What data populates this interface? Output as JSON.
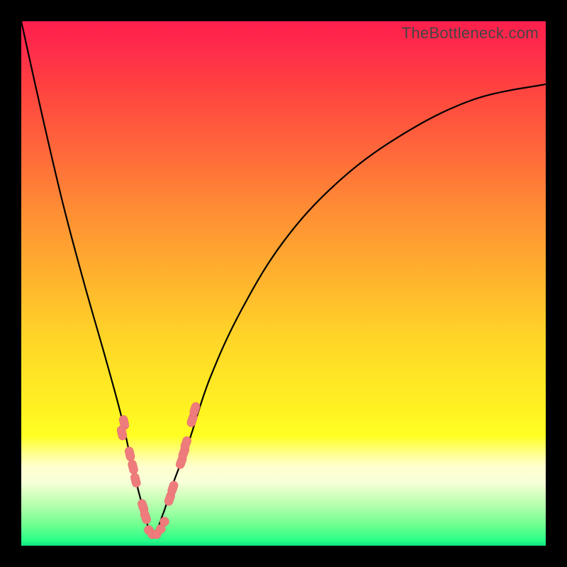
{
  "watermark": "TheBottleneck.com",
  "colors": {
    "background_black": "#000000",
    "gradient_top": "#ff1f4d",
    "gradient_mid": "#ffd428",
    "gradient_bottom": "#10e080",
    "curve": "#000000",
    "bead": "#ef7c7c"
  },
  "chart_data": {
    "type": "line",
    "title": "",
    "xlabel": "",
    "ylabel": "",
    "xlim": [
      0,
      100
    ],
    "ylim": [
      0,
      100
    ],
    "curve": {
      "note": "V-shaped bottleneck curve; minimum near x≈25. y is approximate % height from bottom.",
      "x": [
        0,
        4,
        8,
        12,
        16,
        19,
        21,
        23,
        25,
        27,
        29,
        32,
        36,
        42,
        50,
        60,
        72,
        86,
        100
      ],
      "y": [
        100,
        82,
        65,
        50,
        36,
        25,
        16,
        8,
        2,
        6,
        12,
        20,
        32,
        45,
        58,
        69,
        78,
        85,
        88
      ]
    },
    "beads_left": {
      "note": "Pink capsule markers on descending (left) arm, (x,y) approx.",
      "points": [
        [
          19.6,
          23.5
        ],
        [
          19.2,
          21.5
        ],
        [
          20.7,
          17.5
        ],
        [
          21.3,
          15.0
        ],
        [
          21.8,
          12.5
        ],
        [
          23.2,
          7.5
        ],
        [
          23.7,
          5.5
        ]
      ]
    },
    "beads_right": {
      "note": "Pink capsule markers on ascending (right) arm, (x,y) approx.",
      "points": [
        [
          28.3,
          9.0
        ],
        [
          28.9,
          11.0
        ],
        [
          30.5,
          16.0
        ],
        [
          31.0,
          17.8
        ],
        [
          31.4,
          19.5
        ],
        [
          32.6,
          24.0
        ],
        [
          33.1,
          26.0
        ]
      ]
    },
    "beads_bottom": {
      "note": "Cluster of pink dots around the trough.",
      "points": [
        [
          24.3,
          3.0
        ],
        [
          25.0,
          2.2
        ],
        [
          25.8,
          2.2
        ],
        [
          26.6,
          3.2
        ],
        [
          27.3,
          4.6
        ]
      ]
    }
  }
}
